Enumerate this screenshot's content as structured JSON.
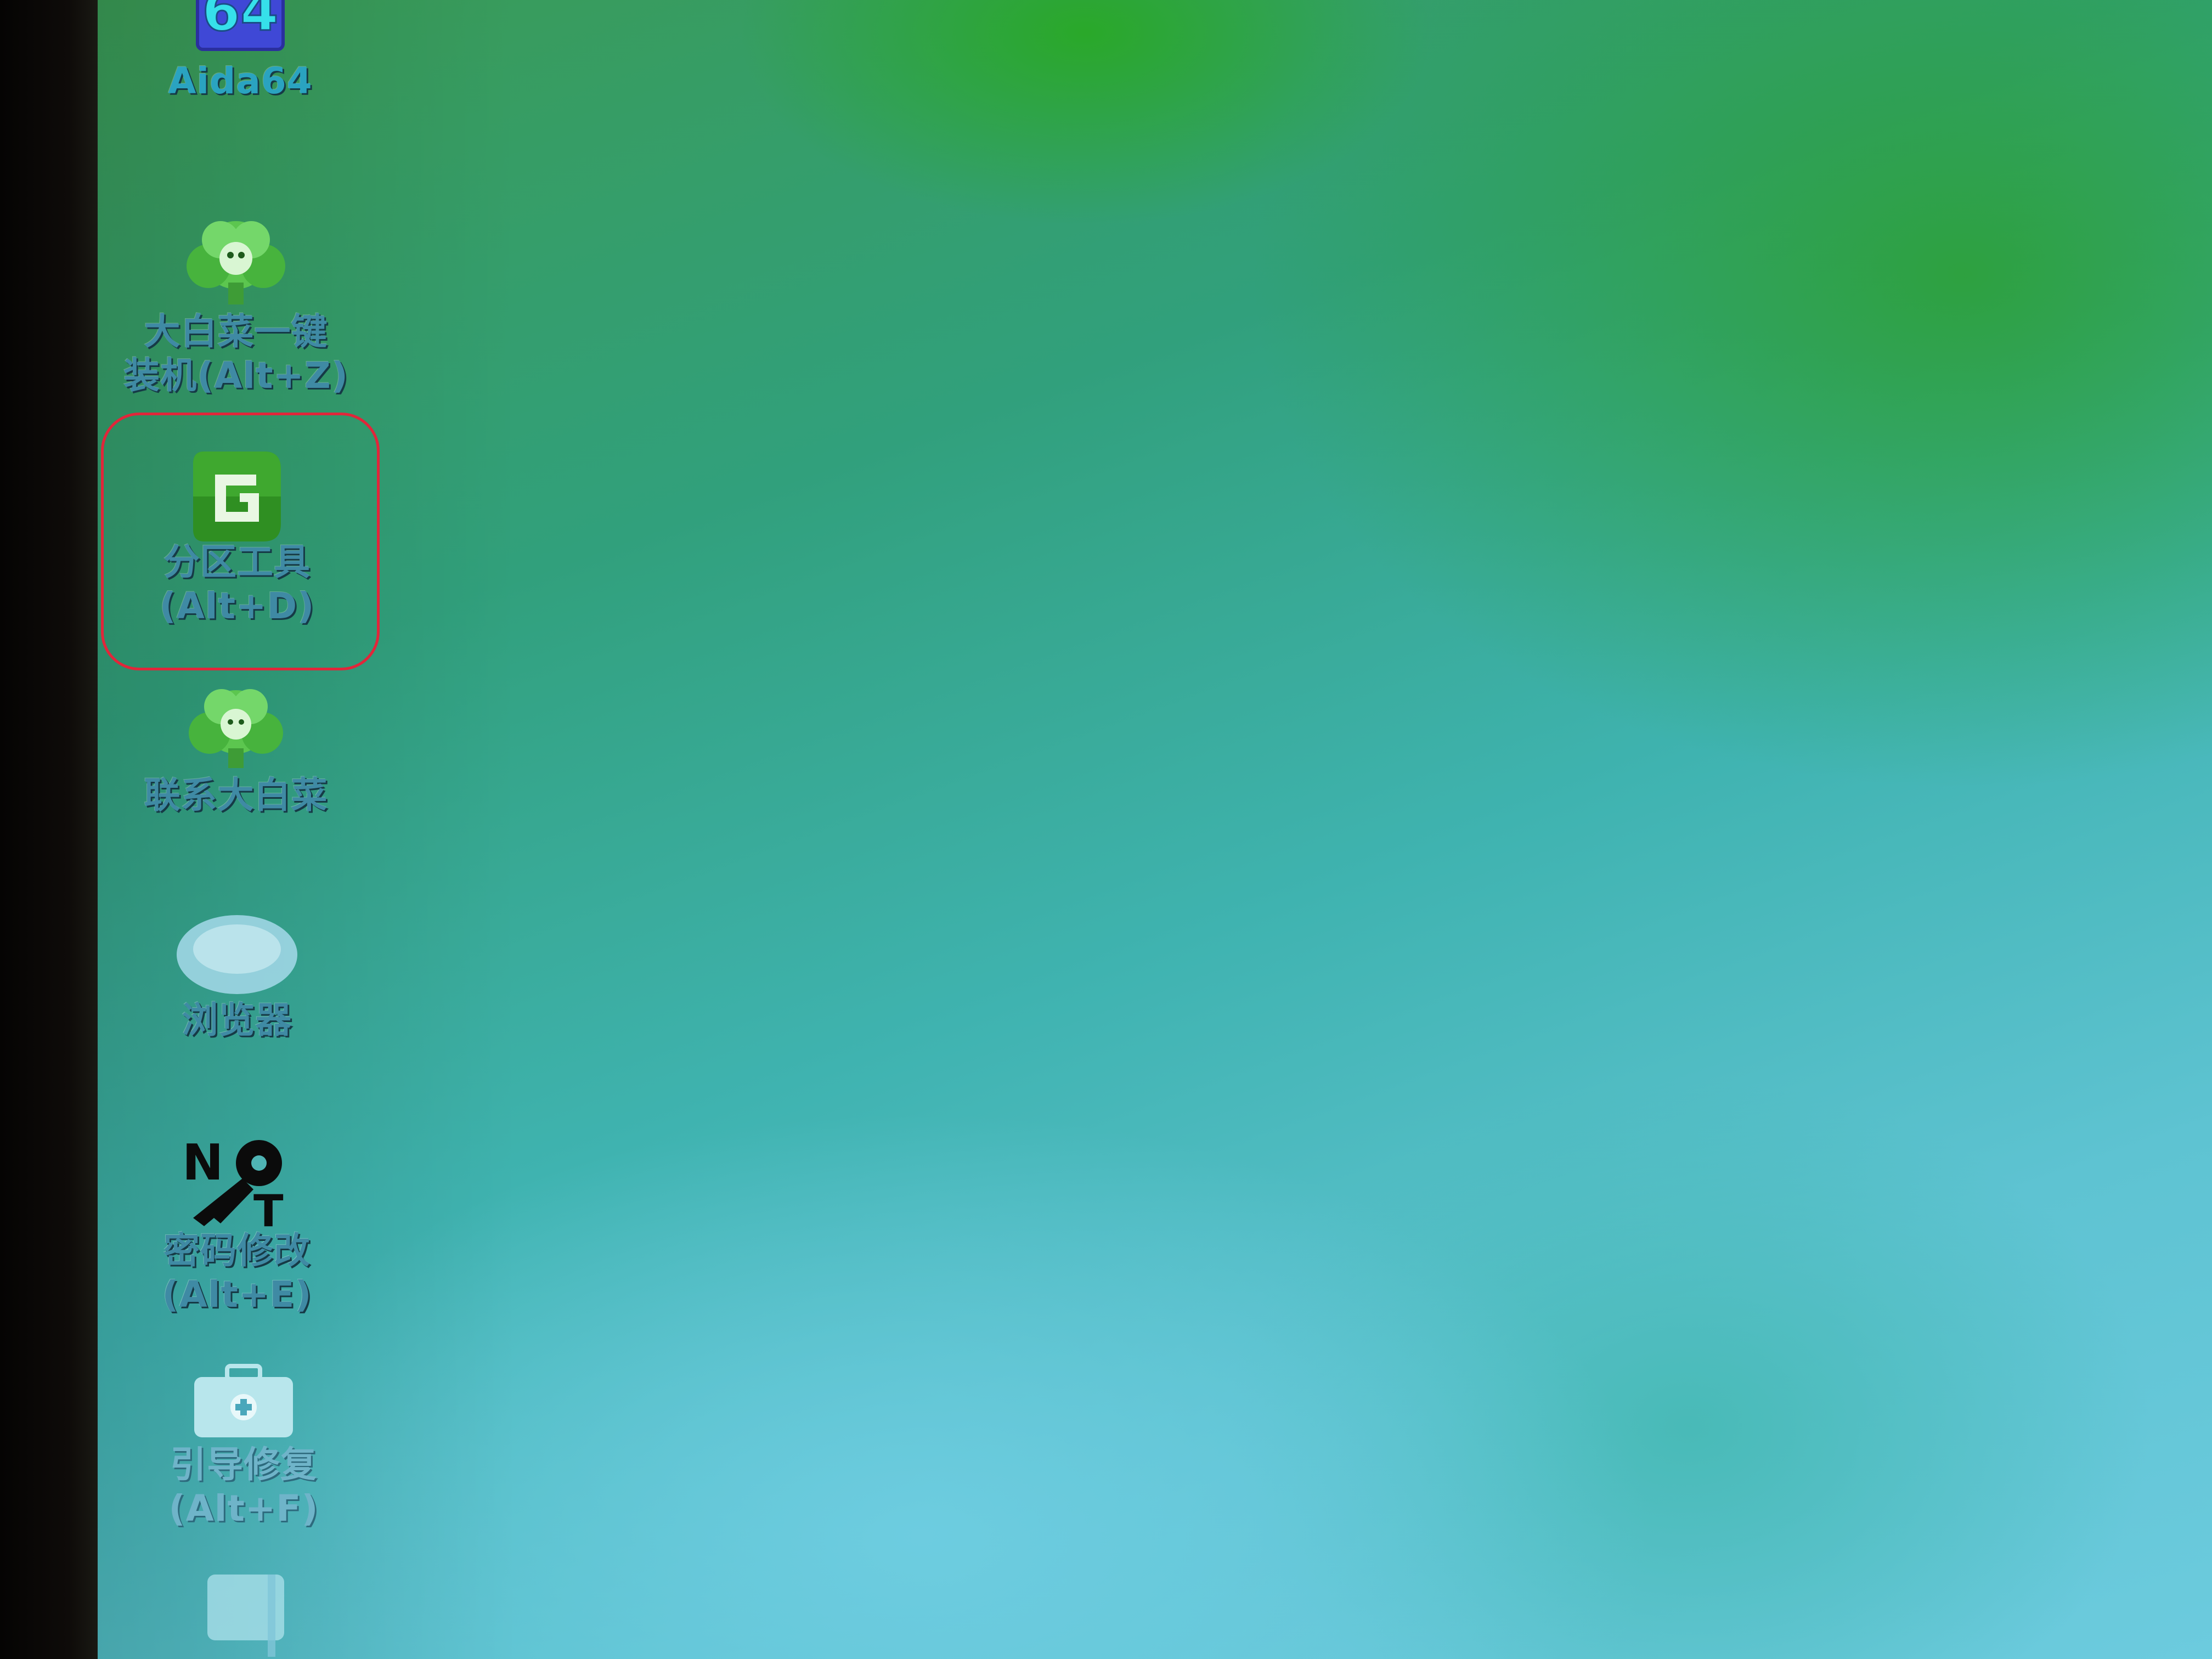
{
  "desktop": {
    "icons": [
      {
        "label": "Aida64",
        "name": "aida64-icon",
        "glyph": "64"
      },
      {
        "label": "大白菜一键\n装机(Alt+Z)",
        "name": "dabaicai-install-icon"
      },
      {
        "label": "分区工具\n(Alt+D)",
        "name": "partition-tool-icon",
        "glyph": "G"
      },
      {
        "label": "联系大白菜",
        "name": "contact-dabaicai-icon"
      },
      {
        "label": "浏览器",
        "name": "browser-icon"
      },
      {
        "label": "密码修改\n(Alt+E)",
        "name": "password-change-icon",
        "glyph": "NT"
      },
      {
        "label": "引导修复\n(Alt+F)",
        "name": "boot-repair-icon"
      },
      {
        "label": "",
        "name": "partial-icon"
      }
    ],
    "selected_index": 2,
    "highlight_color": "#e1263a"
  }
}
